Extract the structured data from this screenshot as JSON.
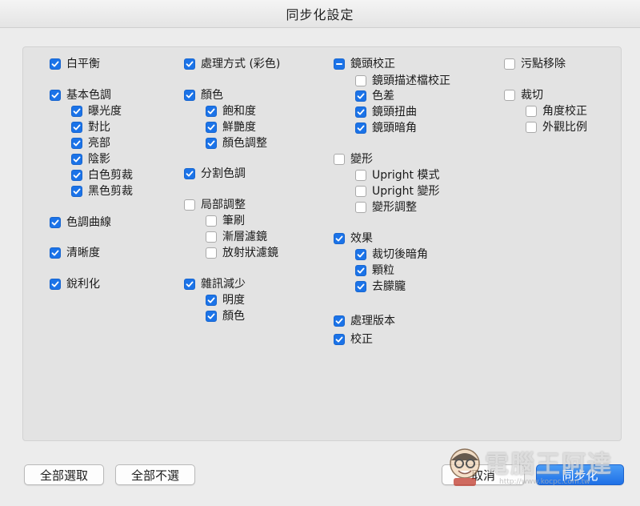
{
  "window": {
    "title": "同步化設定"
  },
  "columns": [
    {
      "items": [
        {
          "label": "白平衡",
          "state": "on",
          "level": 0
        },
        {
          "label": "基本色調",
          "state": "on",
          "level": 0
        },
        {
          "label": "曝光度",
          "state": "on",
          "level": 1
        },
        {
          "label": "對比",
          "state": "on",
          "level": 1
        },
        {
          "label": "亮部",
          "state": "on",
          "level": 1
        },
        {
          "label": "陰影",
          "state": "on",
          "level": 1
        },
        {
          "label": "白色剪裁",
          "state": "on",
          "level": 1
        },
        {
          "label": "黑色剪裁",
          "state": "on",
          "level": 1
        },
        {
          "label": "色調曲線",
          "state": "on",
          "level": 0
        },
        {
          "label": "清晰度",
          "state": "on",
          "level": 0
        },
        {
          "label": "銳利化",
          "state": "on",
          "level": 0
        }
      ]
    },
    {
      "items": [
        {
          "label": "處理方式 (彩色)",
          "state": "on",
          "level": 0
        },
        {
          "label": "顏色",
          "state": "on",
          "level": 0
        },
        {
          "label": "飽和度",
          "state": "on",
          "level": 1
        },
        {
          "label": "鮮艷度",
          "state": "on",
          "level": 1
        },
        {
          "label": "顏色調整",
          "state": "on",
          "level": 1
        },
        {
          "label": "分割色調",
          "state": "on",
          "level": 0
        },
        {
          "label": "局部調整",
          "state": "off",
          "level": 0
        },
        {
          "label": "筆刷",
          "state": "off",
          "level": 1
        },
        {
          "label": "漸層濾鏡",
          "state": "off",
          "level": 1
        },
        {
          "label": "放射狀濾鏡",
          "state": "off",
          "level": 1
        },
        {
          "label": "雜訊減少",
          "state": "on",
          "level": 0
        },
        {
          "label": "明度",
          "state": "on",
          "level": 1
        },
        {
          "label": "顏色",
          "state": "on",
          "level": 1
        }
      ]
    },
    {
      "items": [
        {
          "label": "鏡頭校正",
          "state": "mixed",
          "level": 0
        },
        {
          "label": "鏡頭描述檔校正",
          "state": "off",
          "level": 1
        },
        {
          "label": "色差",
          "state": "on",
          "level": 1
        },
        {
          "label": "鏡頭扭曲",
          "state": "on",
          "level": 1
        },
        {
          "label": "鏡頭暗角",
          "state": "on",
          "level": 1
        },
        {
          "label": "變形",
          "state": "off",
          "level": 0
        },
        {
          "label": "Upright 模式",
          "state": "off",
          "level": 1
        },
        {
          "label": "Upright 變形",
          "state": "off",
          "level": 1
        },
        {
          "label": "變形調整",
          "state": "off",
          "level": 1
        },
        {
          "label": "效果",
          "state": "on",
          "level": 0
        },
        {
          "label": "裁切後暗角",
          "state": "on",
          "level": 1
        },
        {
          "label": "顆粒",
          "state": "on",
          "level": 1
        },
        {
          "label": "去朦朧",
          "state": "on",
          "level": 1
        },
        {
          "label": "處理版本",
          "state": "on",
          "level": 0
        },
        {
          "label": "校正",
          "state": "on",
          "level": 0
        }
      ]
    },
    {
      "items": [
        {
          "label": "污點移除",
          "state": "off",
          "level": 0
        },
        {
          "label": "裁切",
          "state": "off",
          "level": 0
        },
        {
          "label": "角度校正",
          "state": "off",
          "level": 1
        },
        {
          "label": "外觀比例",
          "state": "off",
          "level": 1
        }
      ]
    }
  ],
  "buttons": {
    "select_all": "全部選取",
    "select_none": "全部不選",
    "cancel": "取消",
    "sync": "同步化"
  },
  "watermark": {
    "text": "電腦王阿達",
    "url": "http://www.kocpc.com.tw"
  },
  "colors": {
    "accent": "#1b73e8",
    "panel": "#e3e3e3",
    "window": "#ececec"
  }
}
